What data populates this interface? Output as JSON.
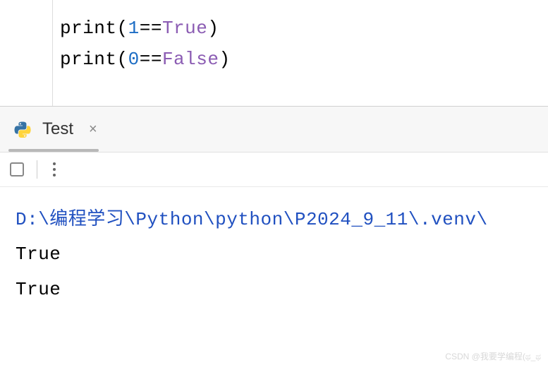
{
  "editor": {
    "line1": {
      "fn": "print",
      "open": "(",
      "num": "1",
      "op": "==",
      "bool": "True",
      "close": ")"
    },
    "line2": {
      "fn": "print",
      "open": "(",
      "num": "0",
      "op": "==",
      "bool": "False",
      "close": ")"
    }
  },
  "tab": {
    "label": "Test",
    "close": "×"
  },
  "console": {
    "path": "D:\\编程学习\\Python\\python\\P2024_9_11\\.venv\\",
    "out1": "True",
    "out2": "True"
  },
  "watermark": "CSDN @我要学编程(ಥ_ಥ"
}
